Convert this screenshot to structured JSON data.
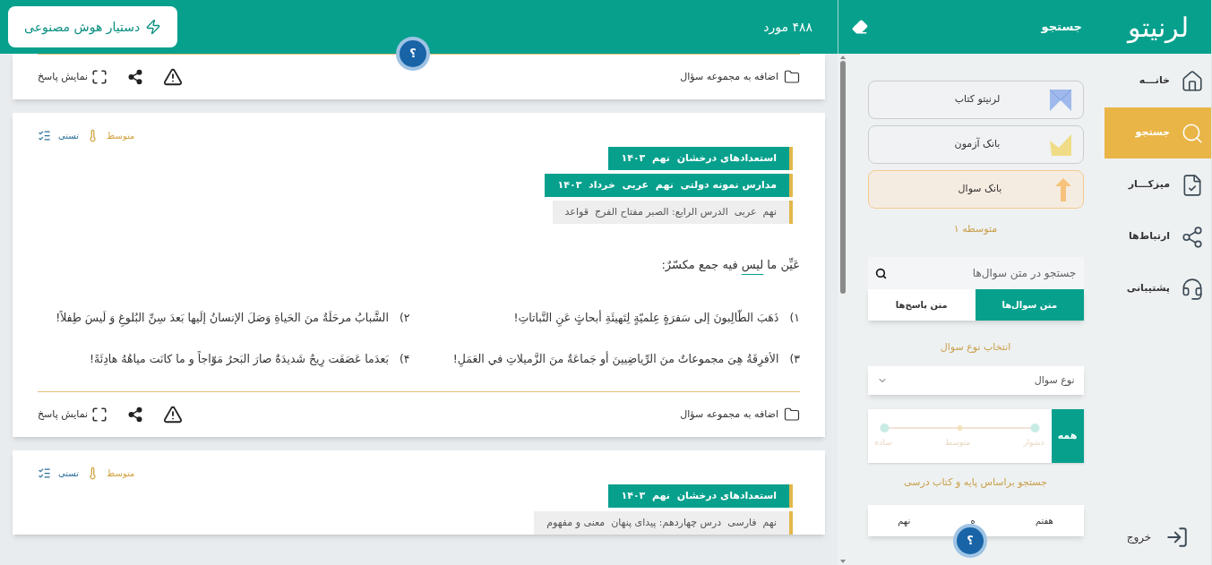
{
  "nav": {
    "logo": "لرنیتو",
    "items": [
      {
        "kind": "home",
        "label": "خانـــه",
        "selected": false
      },
      {
        "kind": "search",
        "label": "جستجو",
        "selected": true
      },
      {
        "kind": "desk",
        "label": "میزکـــار",
        "selected": false
      },
      {
        "kind": "links",
        "label": "ارتباط‌ها",
        "selected": false
      },
      {
        "kind": "support",
        "label": "پشتیبانی",
        "selected": false
      }
    ],
    "logout": "خروج"
  },
  "search_panel": {
    "title": "جستجو",
    "sources": [
      {
        "kind": "book",
        "label": "لرنیتو کتاب",
        "selected": false
      },
      {
        "kind": "exam",
        "label": "بانک آزمون",
        "selected": false
      },
      {
        "kind": "question",
        "label": "بانک سوال",
        "selected": true
      }
    ],
    "level": "متوسطه ۱",
    "search": {
      "placeholder": "جستجو در متن سوال‌ها"
    },
    "scope_tabs": [
      {
        "label": "متن سوال‌ها",
        "selected": true
      },
      {
        "label": "متن پاسخ‌ها",
        "selected": false
      }
    ],
    "type_label": "انتخاب نوع سوال",
    "type_select": {
      "placeholder": "نوع سوال"
    },
    "difficulty": {
      "all_label": "همه",
      "all_selected": true,
      "levels": [
        "دشوار",
        "متوسط",
        "ساده"
      ]
    },
    "grade_label": "جستجو براساس پایه و کتاب درسی",
    "grades": [
      "هفتم",
      "ه",
      "نهم"
    ],
    "help_button": "؟"
  },
  "main": {
    "count": "۴۸۸ مورد",
    "ai_button": "دستیار هوش مصنوعی",
    "help_button": "؟",
    "cards": [
      {
        "footer": {
          "add": "اضافه به مجموعه سؤال",
          "show_answer": "نمایش پاسخ"
        }
      },
      {
        "type": "تستی",
        "difficulty": "متوسط",
        "tags": [
          {
            "kind": "source",
            "text": "استعدادهای درخشان  نهم  ۱۴۰۳"
          },
          {
            "kind": "source",
            "text": "مدارس نمونه دولتی  نهم  عربی  خرداد  ۱۴۰۳"
          },
          {
            "kind": "topic",
            "text": "نهم  عربی  الدرس الرابع: الصبر مفتاح الفرج  قواعد"
          }
        ],
        "question": {
          "before": "عَیِّن ما ",
          "underlined": "لیس",
          "after": " فیه جمع مکسّرٌ:"
        },
        "options": [
          {
            "number": "۱)",
            "text": "ذَهَبَ الطّالِبونَ إلی سَفرَةٍ عِلمیّةٍ لِتَهیئَةِ أبحاثٍ عَنِ النَّباتاتِ!"
          },
          {
            "number": "۲)",
            "text": "الشَّبابُ مرحَلَةٌ منَ الحَیاةِ وَصَلَ الإنسانُ إلَیها بَعدَ سِنِّ البُلوغِ وَ لَیسَ طِفلاً!"
          },
          {
            "number": "۳)",
            "text": "الأفرِقَةُ هِیَ مجموعاتٌ منَ الرِّیاضِیینَ أو جَماعَةٌ منَ الزَّمیلاتِ في العَمَلِ!"
          },
          {
            "number": "۴)",
            "text": "بَعدَما عَصَفَت رِیحٌ شَدیدَةٌ صارَ البَحرُ مَوّاجاً و ما کانَت میاهُهُ هادِئَةً!"
          }
        ],
        "footer": {
          "add": "اضافه به مجموعه سؤال",
          "show_answer": "نمایش پاسخ"
        }
      },
      {
        "type": "تستی",
        "difficulty": "متوسط",
        "tags": [
          {
            "kind": "source",
            "text": "استعدادهای درخشان  نهم  ۱۴۰۳"
          },
          {
            "kind": "topic",
            "text": "نهم  فارسی  درس چهاردهم: پیدای پنهان  معنی و مفهوم"
          }
        ]
      }
    ]
  }
}
